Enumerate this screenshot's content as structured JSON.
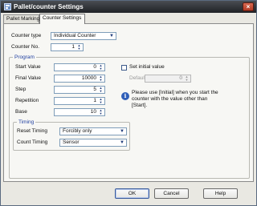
{
  "window": {
    "title": "Pallet/counter Settings",
    "close_glyph": "×"
  },
  "tabs": [
    {
      "label": "Pallet Marking"
    },
    {
      "label": "Counter Settings"
    }
  ],
  "counter": {
    "type_label": "Counter type",
    "type_value": "Individual Counter",
    "no_label": "Counter No.",
    "no_value": "1"
  },
  "program": {
    "title": "Program",
    "start_label": "Start Value",
    "start_value": "0",
    "final_label": "Final Value",
    "final_value": "10000",
    "step_label": "Step",
    "step_value": "5",
    "repetition_label": "Repetition",
    "repetition_value": "1",
    "base_label": "Base",
    "base_value": "10",
    "initial_check_label": "Set initial value",
    "defaults_label": "Defaults",
    "defaults_value": "0",
    "note_lines": [
      "Please use [Initial] when you start the",
      "counter with the value other than",
      "[Start]."
    ]
  },
  "timing": {
    "title": "Timing",
    "reset_label": "Reset Timing",
    "reset_value": "Forcibly only",
    "count_label": "Count Timing",
    "count_value": "Sensor"
  },
  "buttons": {
    "ok": "OK",
    "cancel": "Cancel",
    "help": "Help"
  },
  "icons": {
    "app": "app-icon",
    "info": "info-icon",
    "dropdown": "chevron-down-icon",
    "spinner": "spinner-arrows-icon"
  }
}
